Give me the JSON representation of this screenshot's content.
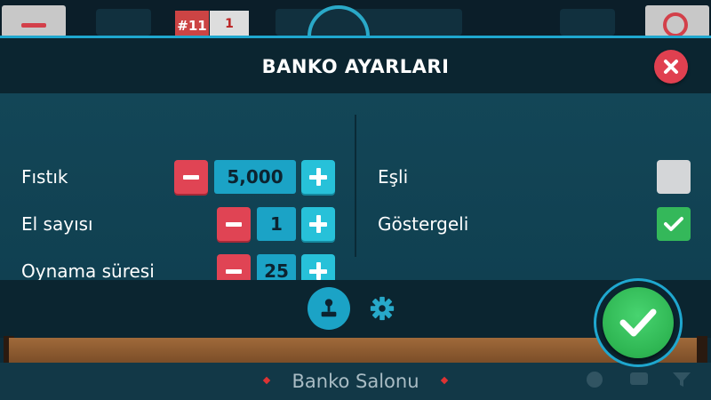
{
  "header": {
    "title": "BANKO AYARLARI"
  },
  "background": {
    "badge_rank": "#11",
    "badge_count": "1",
    "salon_title": "Banko Salonu"
  },
  "settings_left": [
    {
      "label": "Fıstık",
      "value": "5,000"
    },
    {
      "label": "El sayısı",
      "value": "1"
    },
    {
      "label": "Oynama süresi",
      "value": "25"
    }
  ],
  "settings_right": [
    {
      "label": "Eşli",
      "checked": false
    },
    {
      "label": "Göstergeli",
      "checked": true
    }
  ],
  "footer_tabs": [
    {
      "icon": "joystick-icon",
      "active": true
    },
    {
      "icon": "gear-icon",
      "active": false
    }
  ],
  "colors": {
    "accent": "#1fa7cf",
    "minus": "#e04454",
    "plus": "#27c1d9",
    "confirm": "#2eb552",
    "close": "#e04050"
  }
}
